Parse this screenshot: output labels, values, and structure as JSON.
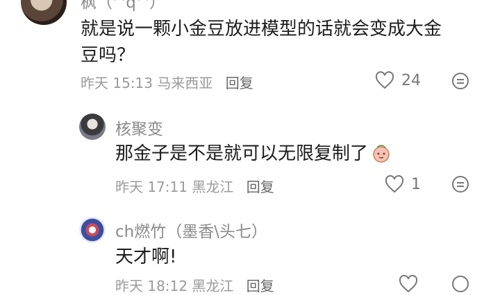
{
  "comments": [
    {
      "name": "枫（^q^）",
      "text_line1": "就是说一颗小金豆放进模型的话就会变成大金",
      "text_line2": "豆吗？",
      "time": "昨天 15:13",
      "location": "马来西亚",
      "reply": "回复",
      "likes": "24"
    },
    {
      "name": "核聚变",
      "text": "那金子是不是就可以无限复制了",
      "time": "昨天 17:11",
      "location": "黑龙江",
      "reply": "回复",
      "likes": "1"
    },
    {
      "name": "ch燃竹（墨香\\头七）",
      "text": "天才啊!",
      "time": "昨天 18:12",
      "location": "黑龙江",
      "reply": "回复"
    }
  ],
  "colors": {
    "text": "#1c1c1c",
    "meta": "#9a9a9a",
    "name": "#8a8a8a"
  }
}
